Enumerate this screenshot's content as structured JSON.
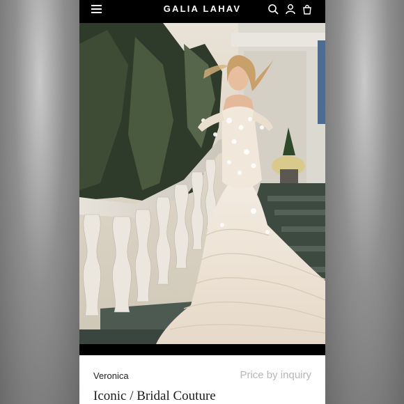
{
  "header": {
    "brand": "GALIA LAHAV",
    "icons": [
      "menu-icon",
      "search-icon",
      "account-icon",
      "bag-icon"
    ]
  },
  "product": {
    "name": "Veronica",
    "price": "Price by inquiry",
    "collection": "Iconic / Bridal Couture"
  },
  "colors": {
    "header_bg": "#000000",
    "price_text": "#b7b7b7",
    "dress": "#efe6da"
  }
}
